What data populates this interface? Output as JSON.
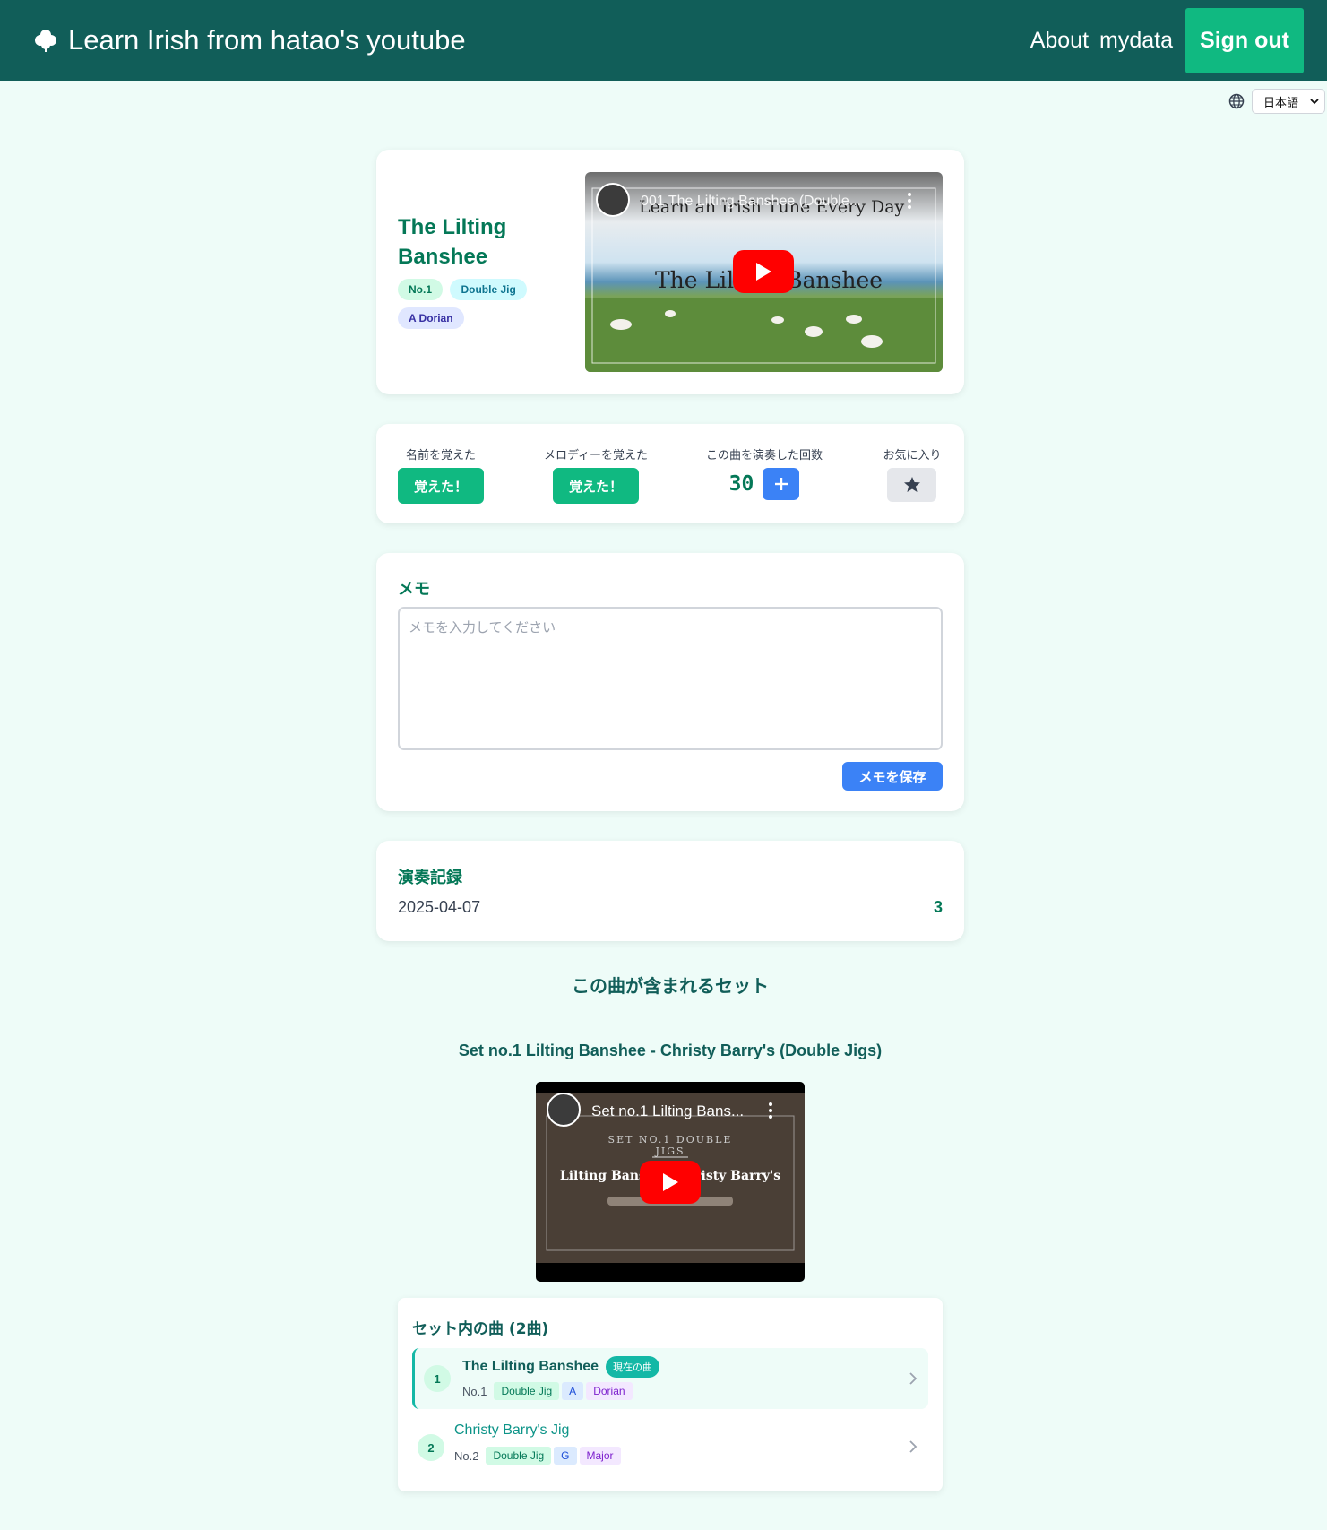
{
  "nav": {
    "brand": "Learn Irish from hatao's youtube",
    "about": "About",
    "mydata": "mydata",
    "signout": "Sign out"
  },
  "language": {
    "selected": "日本語"
  },
  "tune": {
    "title_line1": "The Lilting",
    "title_line2": "Banshee",
    "badges": [
      "No.1",
      "Double Jig",
      "A Dorian"
    ],
    "video": {
      "channel_title": "001 The Lilting Banshee (Double...",
      "overlay_top": "Learn an Irish Tune Every Day",
      "overlay_main": "The Lilting Banshee"
    }
  },
  "stats": {
    "name_label": "名前を覚えた",
    "name_button": "覚えた！",
    "melody_label": "メロディーを覚えた",
    "melody_button": "覚えた！",
    "count_label": "この曲を演奏した回数",
    "count_value": "30",
    "count_plus": "+",
    "fav_label": "お気に入り"
  },
  "memo": {
    "heading": "メモ",
    "placeholder": "メモを入力してください",
    "save_button": "メモを保存"
  },
  "records": {
    "heading": "演奏記録",
    "items": [
      {
        "date": "2025-04-07",
        "count": "3"
      }
    ]
  },
  "sets": {
    "heading": "この曲が含まれるセット",
    "set_title": "Set no.1 Lilting Banshee - Christy Barry's (Double Jigs)",
    "video": {
      "channel_title": "Set no.1 Lilting Bans...",
      "arc_text": "SET NO.1  DOUBLE JIGS",
      "overlay_main": "Lilting Banshee  Christy Barry's"
    },
    "tunes_heading": "セット内の曲 (2曲)",
    "tunes": [
      {
        "index": "1",
        "name": "The Lilting Banshee",
        "current_badge": "現在の曲",
        "no": "No.1",
        "type": "Double Jig",
        "key": "A",
        "mode": "Dorian"
      },
      {
        "index": "2",
        "name": "Christy Barry's Jig",
        "no": "No.2",
        "type": "Double Jig",
        "key": "G",
        "mode": "Major"
      }
    ]
  },
  "colors": {
    "nav_bg": "#115e59",
    "accent_green": "#10b981",
    "title_green": "#047857",
    "blue": "#3b82f6",
    "page_bg": "#eefcf8"
  }
}
